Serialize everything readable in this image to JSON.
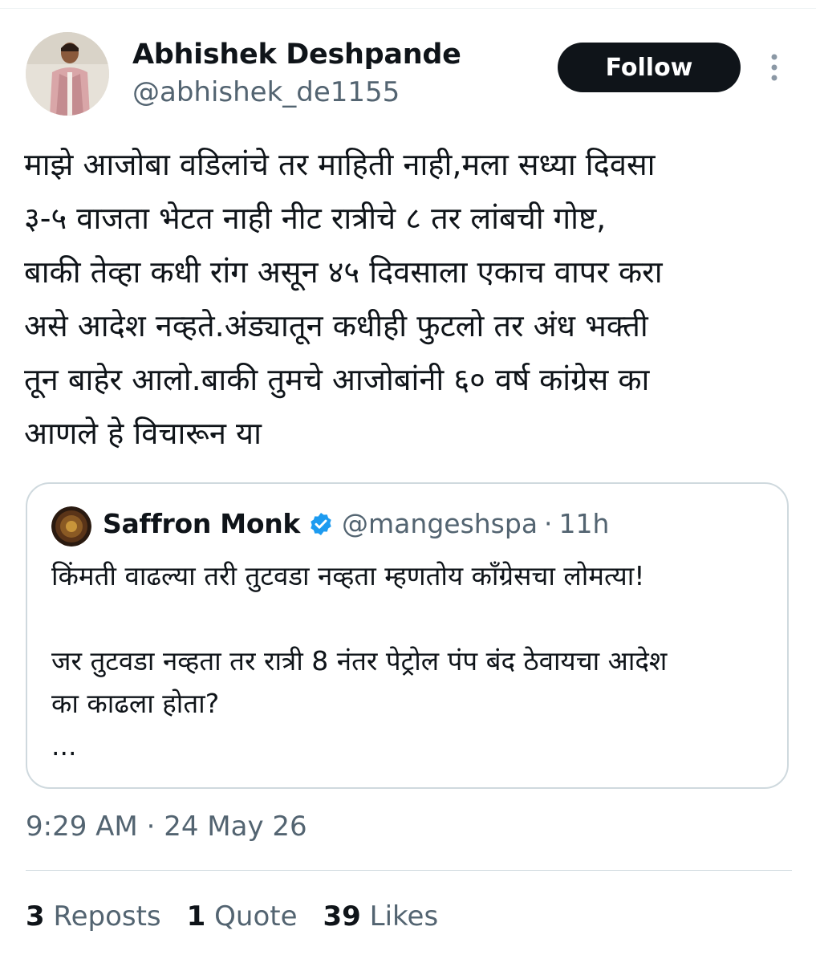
{
  "tweet": {
    "author": {
      "name": "Abhishek Deshpande",
      "handle": "@abhishek_de1155"
    },
    "follow_label": "Follow",
    "text": "माझे आजोबा वडिलांचे तर माहिती नाही,मला सध्या दिवसा\n३-५ वाजता भेटत नाही नीट रात्रीचे ८ तर लांबची गोष्ट,\nबाकी तेव्हा कधी रांग असून ४५ दिवसाला एकाच वापर करा\nअसे आदेश नव्हते.अंड्यातून कधीही फुटलो तर अंध भक्ती\nतून बाहेर आलो.बाकी तुमचे आजोबांनी ६० वर्ष कांग्रेस का\nआणले हे विचारून या",
    "quoted": {
      "name": "Saffron Monk",
      "handle": "@mangeshspa",
      "separator": "·",
      "time": "11h",
      "text": "किंमती वाढल्या तरी तुटवडा नव्हता म्हणतोय काँग्रेसचा लोमत्या!\n\nजर तुटवडा नव्हता तर रात्री 8 नंतर पेट्रोल पंप बंद ठेवायचा आदेश\nका काढला होता?\n..."
    },
    "timestamp": {
      "time": "9:29 AM",
      "separator": "·",
      "date": "24 May 26"
    },
    "stats": [
      {
        "count": "3",
        "label": "Reposts"
      },
      {
        "count": "1",
        "label": "Quote"
      },
      {
        "count": "39",
        "label": "Likes"
      }
    ]
  },
  "icons": {
    "more": "more-vertical-icon",
    "verified": "verified-badge-icon"
  },
  "colors": {
    "text": "#0f1419",
    "secondary": "#536471",
    "border": "#cfd9de",
    "verified": "#1d9bf0",
    "follow_bg": "#0f1419"
  }
}
